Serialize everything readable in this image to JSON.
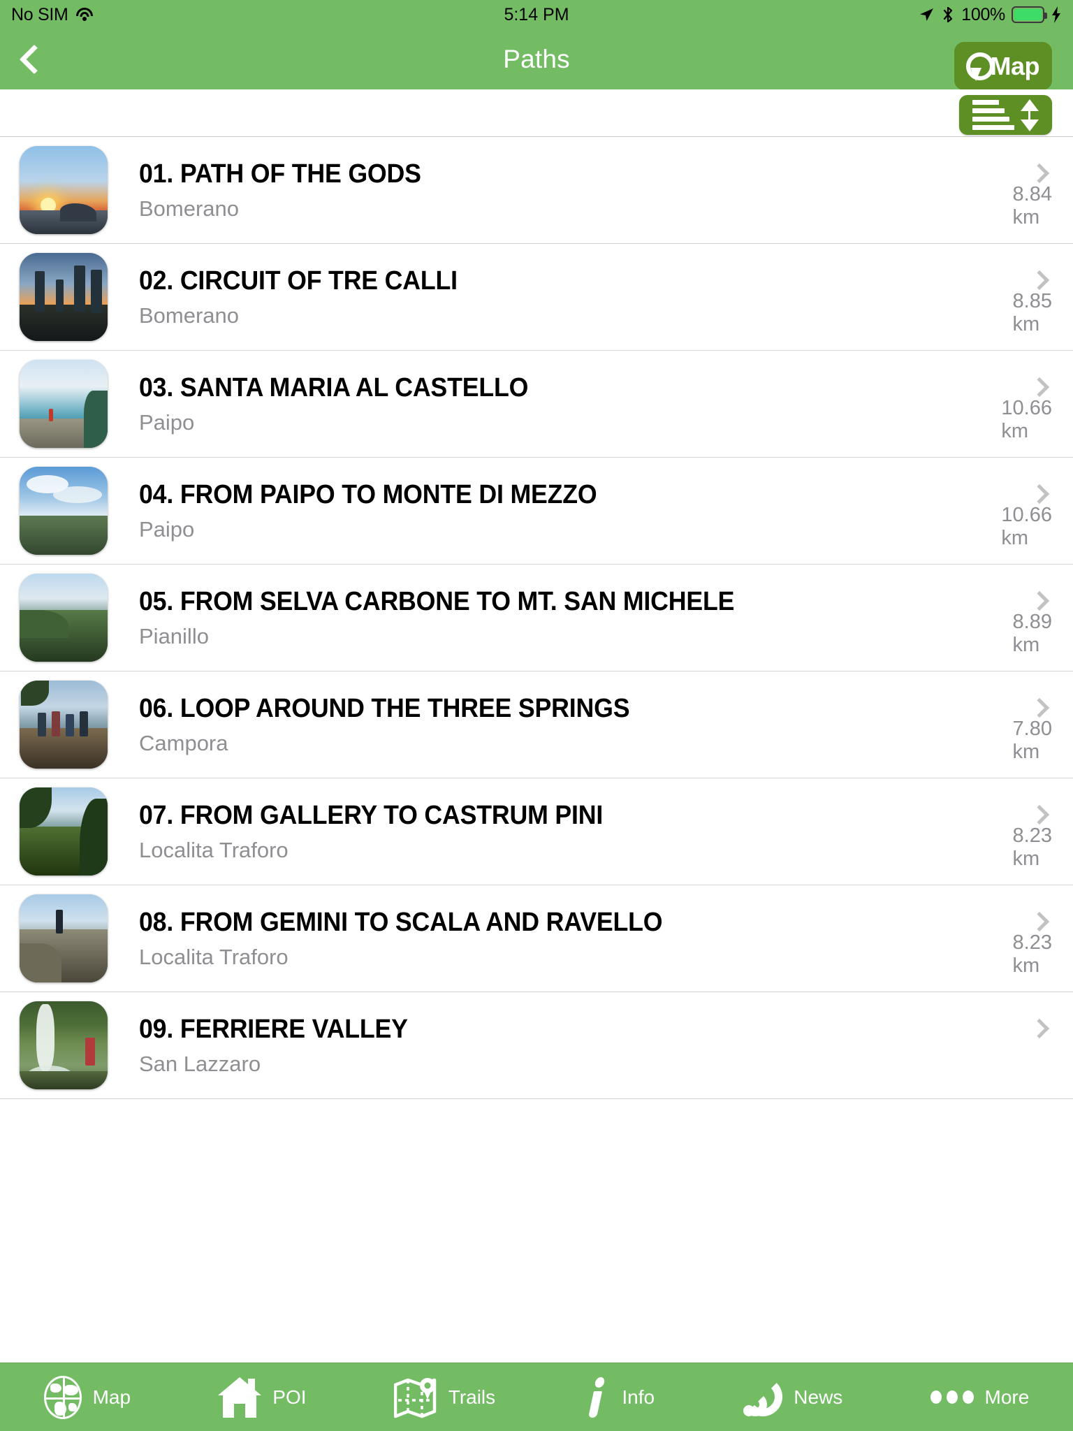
{
  "statusbar": {
    "carrier": "No SIM",
    "wifi_icon": "wifi-icon",
    "time": "5:14 PM",
    "location_icon": "location-arrow-icon",
    "bluetooth_icon": "bluetooth-icon",
    "battery_percent": "100%",
    "battery_icon": "battery-full-icon",
    "charging_icon": "lightning-bolt-icon"
  },
  "navbar": {
    "back_icon": "chevron-left-icon",
    "title": "Paths",
    "map_button": {
      "label": "Map",
      "icon": "map-pin-icon"
    }
  },
  "toolbar": {
    "sort_button": {
      "icon": "sort-lines-arrows-icon",
      "label": ""
    }
  },
  "colors": {
    "brand_green": "#73BC64",
    "button_green": "#5d8f24",
    "subtitle_gray": "#8e8e93",
    "chevron_gray": "#c2c2c2",
    "separator": "#d6d6d6"
  },
  "list": {
    "rows": [
      {
        "title": "01. PATH OF THE GODS",
        "subtitle": "Bomerano",
        "distance": "8.84 km",
        "thumb": "sunset-over-sea-thumbnail"
      },
      {
        "title": "02. CIRCUIT OF TRE CALLI",
        "subtitle": "Bomerano",
        "distance": "8.85 km",
        "thumb": "hikers-at-sunset-thumbnail"
      },
      {
        "title": "03. SANTA MARIA AL CASTELLO",
        "subtitle": "Paipo",
        "distance": "10.66 km",
        "thumb": "coastal-cliff-viewpoint-thumbnail"
      },
      {
        "title": "04. FROM PAIPO TO MONTE DI MEZZO",
        "subtitle": "Paipo",
        "distance": "10.66 km",
        "thumb": "clouds-over-ridge-thumbnail"
      },
      {
        "title": "05. FROM SELVA CARBONE TO MT. SAN MICHELE",
        "subtitle": "Pianillo",
        "distance": "8.89 km",
        "thumb": "green-mountain-slope-thumbnail"
      },
      {
        "title": "06. LOOP AROUND THE THREE SPRINGS",
        "subtitle": "Campora",
        "distance": "7.80 km",
        "thumb": "group-on-summit-thumbnail"
      },
      {
        "title": "07. FROM GALLERY TO CASTRUM PINI",
        "subtitle": "Localita Traforo",
        "distance": "8.23 km",
        "thumb": "forest-trail-sea-view-thumbnail"
      },
      {
        "title": "08. FROM GEMINI TO SCALA AND RAVELLO",
        "subtitle": "Localita Traforo",
        "distance": "8.23 km",
        "thumb": "hiker-on-rock-thumbnail"
      },
      {
        "title": "09. FERRIERE VALLEY",
        "subtitle": "San Lazzaro",
        "distance": "",
        "thumb": "waterfall-thumbnail"
      }
    ]
  },
  "tabbar": {
    "items": [
      {
        "label": "Map",
        "icon": "globe-icon"
      },
      {
        "label": "POI",
        "icon": "house-icon"
      },
      {
        "label": "Trails",
        "icon": "folded-map-pin-icon"
      },
      {
        "label": "Info",
        "icon": "info-i-icon"
      },
      {
        "label": "News",
        "icon": "rss-icon"
      },
      {
        "label": "More",
        "icon": "ellipsis-icon"
      }
    ]
  }
}
